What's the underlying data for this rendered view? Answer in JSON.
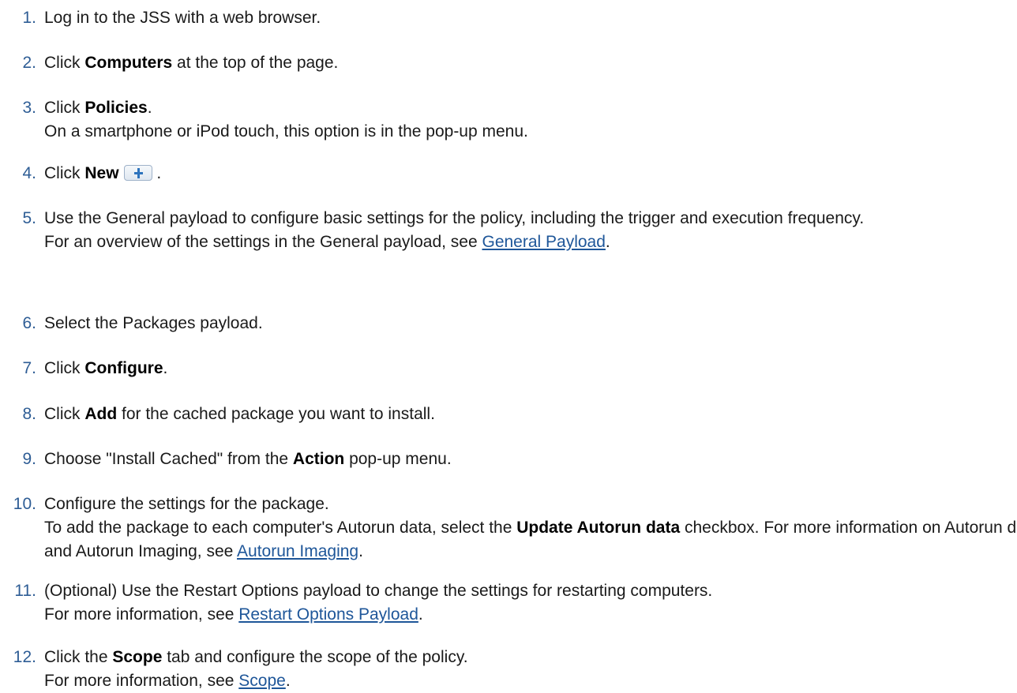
{
  "steps": [
    {
      "num": "1.",
      "parts": [
        {
          "t": "Log in to the JSS with a web browser."
        }
      ]
    },
    {
      "num": "2.",
      "parts": [
        {
          "t": "Click "
        },
        {
          "b": "Computers"
        },
        {
          "t": " at the top of the page."
        }
      ]
    },
    {
      "num": "3.",
      "parts": [
        {
          "t": "Click "
        },
        {
          "b": "Policies"
        },
        {
          "t": "."
        }
      ],
      "sub": [
        {
          "t": "On a smartphone or iPod touch, this option is in the pop-up menu."
        }
      ]
    },
    {
      "num": "4.",
      "parts": [
        {
          "t": "Click "
        },
        {
          "b": "New"
        },
        {
          "icon": "plus-icon"
        },
        {
          "t": " ."
        }
      ]
    },
    {
      "num": "5.",
      "parts": [
        {
          "t": "Use the General payload to configure basic settings for the policy, including the trigger and execution frequency."
        }
      ],
      "sub": [
        {
          "t": "For an overview of the settings in the General payload, see "
        },
        {
          "link": "General Payload"
        },
        {
          "t": "."
        }
      ]
    },
    {
      "num": "6.",
      "parts": [
        {
          "t": "Select the Packages payload."
        }
      ]
    },
    {
      "num": "7.",
      "parts": [
        {
          "t": "Click "
        },
        {
          "b": "Configure"
        },
        {
          "t": "."
        }
      ]
    },
    {
      "num": "8.",
      "parts": [
        {
          "t": "Click "
        },
        {
          "b": "Add"
        },
        {
          "t": " for the cached package you want to install."
        }
      ]
    },
    {
      "num": "9.",
      "parts": [
        {
          "t": "Choose \"Install Cached\" from the "
        },
        {
          "b": "Action"
        },
        {
          "t": " pop-up menu."
        }
      ]
    },
    {
      "num": "10.",
      "parts": [
        {
          "t": "Configure the settings for the package."
        }
      ],
      "sub": [
        {
          "t": "To add the package to each computer's Autorun data, select the "
        },
        {
          "b": "Update Autorun data"
        },
        {
          "t": " checkbox. For more information on Autorun data and Autorun Imaging, see "
        },
        {
          "link": "Autorun Imaging"
        },
        {
          "t": "."
        }
      ]
    },
    {
      "num": "11.",
      "parts": [
        {
          "t": "(Optional) Use the Restart Options payload to change the settings for restarting computers."
        }
      ],
      "sub": [
        {
          "t": "For more information, see "
        },
        {
          "link": "Restart Options Payload"
        },
        {
          "t": "."
        }
      ]
    },
    {
      "num": "12.",
      "parts": [
        {
          "t": "Click the "
        },
        {
          "b": "Scope"
        },
        {
          "t": " tab and configure the scope of the policy."
        }
      ],
      "sub": [
        {
          "t": "For more information, see "
        },
        {
          "link": "Scope"
        },
        {
          "t": "."
        }
      ]
    }
  ]
}
